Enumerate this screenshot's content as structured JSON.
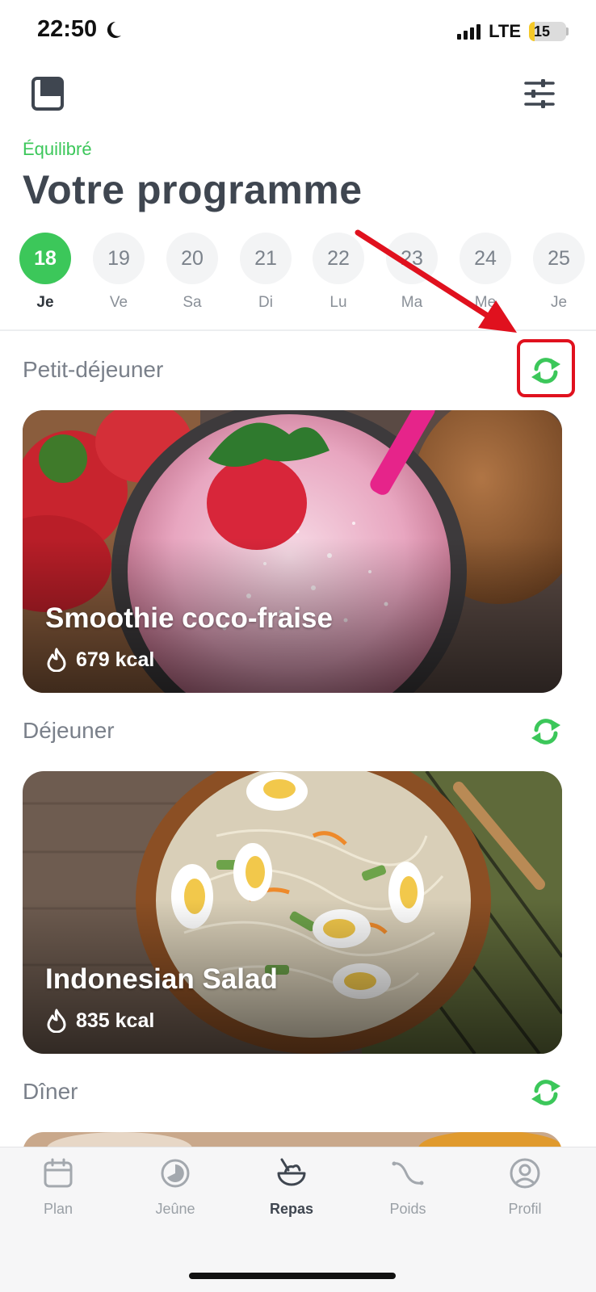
{
  "status_bar": {
    "time": "22:50",
    "network": "LTE",
    "battery_level": "15",
    "battery_fraction": 0.15,
    "battery_color": "#f5c928"
  },
  "header": {
    "left_icon": "book-icon",
    "right_icon": "sliders-icon",
    "plan_type": "Équilibré",
    "title": "Votre programme"
  },
  "colors": {
    "accent": "#3cc75a",
    "annotation": "#e0111e",
    "text_dark": "#3f4650"
  },
  "days": [
    {
      "number": "18",
      "label": "Je",
      "selected": true
    },
    {
      "number": "19",
      "label": "Ve",
      "selected": false
    },
    {
      "number": "20",
      "label": "Sa",
      "selected": false
    },
    {
      "number": "21",
      "label": "Di",
      "selected": false
    },
    {
      "number": "22",
      "label": "Lu",
      "selected": false
    },
    {
      "number": "23",
      "label": "Ma",
      "selected": false
    },
    {
      "number": "24",
      "label": "Me",
      "selected": false
    },
    {
      "number": "25",
      "label": "Je",
      "selected": false
    }
  ],
  "meals": [
    {
      "section": "Petit-déjeuner",
      "name": "Smoothie coco-fraise",
      "kcal": "679 kcal",
      "refresh_icon": "refresh-icon"
    },
    {
      "section": "Déjeuner",
      "name": "Indonesian Salad",
      "kcal": "835 kcal",
      "refresh_icon": "refresh-icon"
    },
    {
      "section": "Dîner",
      "name": "",
      "kcal": "",
      "refresh_icon": "refresh-icon"
    }
  ],
  "nav": [
    {
      "label": "Plan",
      "icon": "calendar-icon",
      "active": false
    },
    {
      "label": "Jeûne",
      "icon": "timer-icon",
      "active": false
    },
    {
      "label": "Repas",
      "icon": "bowl-icon",
      "active": true
    },
    {
      "label": "Poids",
      "icon": "weight-curve-icon",
      "active": false
    },
    {
      "label": "Profil",
      "icon": "profile-icon",
      "active": false
    }
  ]
}
